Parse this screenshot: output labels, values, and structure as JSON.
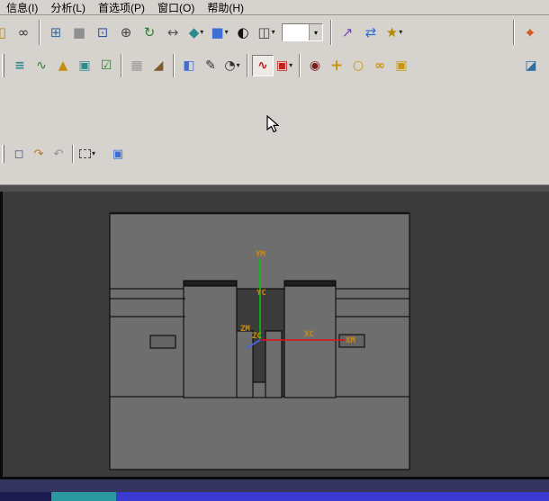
{
  "menubar": {
    "items": [
      {
        "label": "信息(I)"
      },
      {
        "label": "分析(L)"
      },
      {
        "label": "首选项(P)"
      },
      {
        "label": "窗口(O)"
      },
      {
        "label": "帮助(H)"
      }
    ]
  },
  "ui": {
    "dropdown_glyph": "▾"
  },
  "toolbar_main": {
    "buttons": [
      {
        "name": "export-icon",
        "glyph": "◫"
      },
      {
        "name": "find-icon",
        "glyph": "∞"
      },
      {
        "name": "tile-windows-icon",
        "glyph": "⊞"
      },
      {
        "name": "fit-view-icon",
        "glyph": "■"
      },
      {
        "name": "zoom-window-icon",
        "glyph": "⊡"
      },
      {
        "name": "zoom-icon",
        "glyph": "⊕"
      },
      {
        "name": "rotate-view-icon",
        "glyph": "↻"
      },
      {
        "name": "pan-view-icon",
        "glyph": "↔"
      },
      {
        "name": "shaded-view-icon",
        "glyph": "◆"
      },
      {
        "name": "isometric-view-icon",
        "glyph": "■"
      },
      {
        "name": "display-mode-icon",
        "glyph": "◐"
      },
      {
        "name": "layout-icon",
        "glyph": "◫"
      },
      {
        "name": "move-component-icon",
        "glyph": "↗"
      },
      {
        "name": "swap-component-icon",
        "glyph": "⇄"
      },
      {
        "name": "pattern-icon",
        "glyph": "★"
      },
      {
        "name": "wcs-icon",
        "glyph": "⌖"
      }
    ],
    "view_combo_value": ""
  },
  "toolbar_second": {
    "buttons": [
      {
        "name": "program-order-icon",
        "glyph": "≡"
      },
      {
        "name": "process-curve-icon",
        "glyph": "∿"
      },
      {
        "name": "create-geometry-icon",
        "glyph": "▲"
      },
      {
        "name": "mold-csys-icon",
        "glyph": "▣"
      },
      {
        "name": "checklist-icon",
        "glyph": "☑"
      },
      {
        "name": "blank-block-icon",
        "glyph": "▦"
      },
      {
        "name": "tool-cone-icon",
        "glyph": "◢"
      },
      {
        "name": "workpiece-icon",
        "glyph": "◧"
      },
      {
        "name": "edit-sheet-icon",
        "glyph": "✎"
      },
      {
        "name": "time-report-icon",
        "glyph": "◔"
      },
      {
        "name": "waveform-icon",
        "glyph": "∿"
      },
      {
        "name": "motion-sim-icon",
        "glyph": "▣"
      },
      {
        "name": "check-glasses-icon",
        "glyph": "◉"
      },
      {
        "name": "gold-plus-icon",
        "glyph": "+"
      },
      {
        "name": "gold-circle-icon",
        "glyph": "○"
      },
      {
        "name": "gold-link-icon",
        "glyph": "∞"
      },
      {
        "name": "gold-group-icon",
        "glyph": "▣"
      },
      {
        "name": "right-box-icon",
        "glyph": "◪"
      }
    ]
  },
  "toolbar_mini": {
    "buttons": [
      {
        "name": "display-part-icon",
        "glyph": "◻"
      },
      {
        "name": "redo-arrow-icon",
        "glyph": "↷"
      },
      {
        "name": "undo-arrow-icon",
        "glyph": "↶"
      },
      {
        "name": "selection-box-icon",
        "glyph": ""
      },
      {
        "name": "work-part-cube-icon",
        "glyph": "▣"
      }
    ]
  },
  "viewport": {
    "labels": {
      "ym": "YM",
      "yc": "YC",
      "zm": "ZM",
      "zc": "ZC",
      "xc": "XC",
      "xm": "XM"
    },
    "colors": {
      "background": "#3b3b3b",
      "model_gray": "#6e6e6e",
      "axis_x": "#e81010",
      "axis_y": "#00cc00",
      "axis_z": "#4a5fe0",
      "label_orange": "#cf8a0e"
    }
  },
  "statusbar": {
    "colors": {
      "navy": "#34345e",
      "dark_navy": "#1c1c50",
      "teal": "#2a9aa0",
      "blue": "#3a3ad0"
    }
  }
}
